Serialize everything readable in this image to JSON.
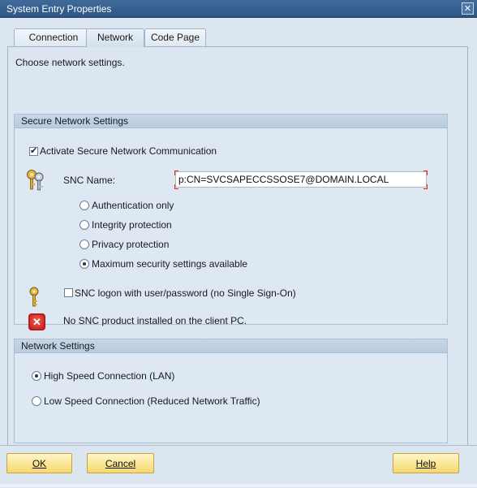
{
  "window": {
    "title": "System Entry Properties",
    "close_symbol": "✕"
  },
  "tabs": [
    {
      "label": "Connection",
      "active": false
    },
    {
      "label": "Network",
      "active": true
    },
    {
      "label": "Code Page",
      "active": false
    }
  ],
  "intro_text": "Choose network settings.",
  "secure_group": {
    "title": "Secure Network Settings",
    "activate_snc": {
      "label": "Activate Secure Network Communication",
      "checked": true
    },
    "snc_name": {
      "label": "SNC Name:",
      "value": "p:CN=SVCSAPECCSSOSE7@DOMAIN.LOCAL"
    },
    "protection_options": [
      {
        "label": "Authentication only",
        "selected": false
      },
      {
        "label": "Integrity protection",
        "selected": false
      },
      {
        "label": "Privacy protection",
        "selected": false
      },
      {
        "label": "Maximum security settings available",
        "selected": true
      }
    ],
    "snc_logon": {
      "label": "SNC logon with user/password (no Single Sign-On)",
      "checked": false
    },
    "error_message": "No SNC product installed on the client PC."
  },
  "network_group": {
    "title": "Network Settings",
    "options": [
      {
        "label": "High Speed Connection (LAN)",
        "selected": true
      },
      {
        "label": "Low Speed Connection (Reduced Network Traffic)",
        "selected": false
      }
    ]
  },
  "buttons": {
    "ok": "OK",
    "cancel": "Cancel",
    "help": "Help"
  },
  "colors": {
    "titlebar": "#2c5582",
    "panel": "#dce6f1",
    "button": "#f6d86d",
    "error": "#c42020"
  },
  "icons": [
    "key-pair-icon",
    "key-icon",
    "error-icon",
    "close-icon"
  ]
}
